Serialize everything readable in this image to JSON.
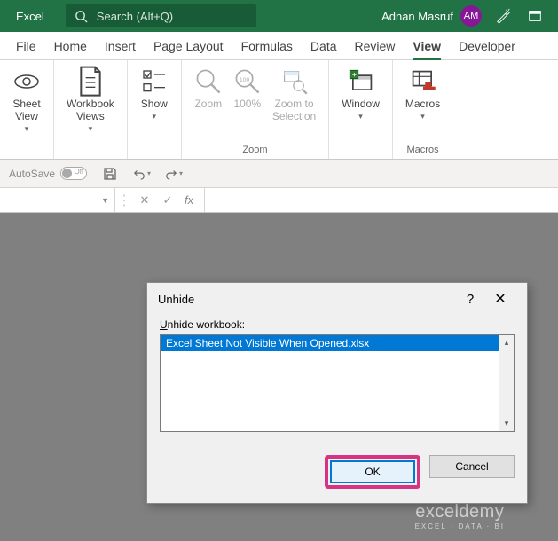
{
  "title": {
    "app": "Excel",
    "search_placeholder": "Search (Alt+Q)",
    "user": "Adnan Masruf",
    "initials": "AM"
  },
  "tabs": {
    "file": "File",
    "home": "Home",
    "insert": "Insert",
    "page_layout": "Page Layout",
    "formulas": "Formulas",
    "data": "Data",
    "review": "Review",
    "view": "View",
    "developer": "Developer"
  },
  "ribbon": {
    "sheet_view": "Sheet\nView",
    "workbook_views": "Workbook\nViews",
    "show": "Show",
    "zoom": "Zoom",
    "pct100": "100%",
    "zoom_sel": "Zoom to\nSelection",
    "window": "Window",
    "macros": "Macros",
    "group_zoom": "Zoom",
    "group_macros": "Macros"
  },
  "qat": {
    "autosave": "AutoSave"
  },
  "formula_bar": {
    "fx": "fx"
  },
  "dialog": {
    "title": "Unhide",
    "label_pre": "U",
    "label_rest": "nhide workbook:",
    "item": "Excel Sheet Not Visible When Opened.xlsx",
    "ok": "OK",
    "cancel": "Cancel"
  },
  "watermark": {
    "main": "exceldemy",
    "sub": "EXCEL · DATA · BI"
  }
}
